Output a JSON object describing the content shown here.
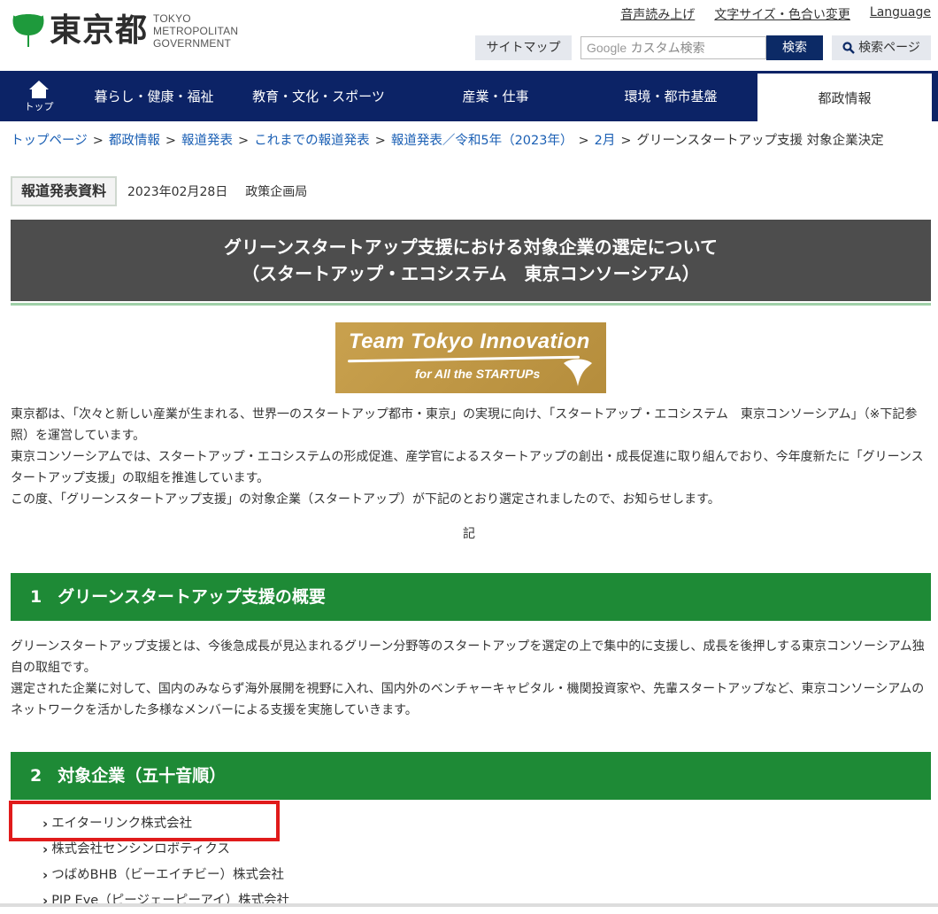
{
  "header": {
    "logo_kanji": "東京都",
    "logo_en_line1": "TOKYO METROPOLITAN",
    "logo_en_line2": "GOVERNMENT",
    "util_links": [
      "音声読み上げ",
      "文字サイズ・色合い変更",
      "Language"
    ],
    "sitemap_label": "サイトマップ",
    "search_google": "Google",
    "search_placeholder": "カスタム検索",
    "search_button": "検索",
    "search_page_button": "検索ページ"
  },
  "nav": {
    "home_label": "トップ",
    "items": [
      "暮らし・健康・福祉",
      "教育・文化・スポーツ",
      "産業・仕事",
      "環境・都市基盤",
      "都政情報"
    ],
    "active_index": 4
  },
  "breadcrumb": {
    "links": [
      "トップページ",
      "都政情報",
      "報道発表",
      "これまでの報道発表",
      "報道発表／令和5年（2023年）",
      "2月"
    ],
    "current": "グリーンスタートアップ支援 対象企業決定"
  },
  "meta": {
    "badge": "報道発表資料",
    "date": "2023年02月28日",
    "department": "政策企画局"
  },
  "title": {
    "line1": "グリーンスタートアップ支援における対象企業の選定について",
    "line2": "（スタートアップ・エコシステム　東京コンソーシアム）"
  },
  "banner": {
    "title": "Team Tokyo Innovation",
    "subtitle": "for All the STARTUPs"
  },
  "intro": {
    "p1": "東京都は、「次々と新しい産業が生まれる、世界一のスタートアップ都市・東京」の実現に向け、「スタートアップ・エコシステム　東京コンソーシアム」（※下記参照）を運営しています。",
    "p2": "東京コンソーシアムでは、スタートアップ・エコシステムの形成促進、産学官によるスタートアップの創出・成長促進に取り組んでおり、今年度新たに「グリーンスタートアップ支援」の取組を推進しています。",
    "p3": "この度、「グリーンスタートアップ支援」の対象企業（スタートアップ）が下記のとおり選定されましたので、お知らせします。",
    "ki": "記"
  },
  "section1": {
    "num": "1",
    "title": "グリーンスタートアップ支援の概要",
    "p1": "グリーンスタートアップ支援とは、今後急成長が見込まれるグリーン分野等のスタートアップを選定の上で集中的に支援し、成長を後押しする東京コンソーシアム独自の取組です。",
    "p2": "選定された企業に対して、国内のみならず海外展開を視野に入れ、国内外のベンチャーキャピタル・機関投資家や、先輩スタートアップなど、東京コンソーシアムのネットワークを活かした多様なメンバーによる支援を実施していきます。"
  },
  "section2": {
    "num": "2",
    "title": "対象企業（五十音順）",
    "companies": [
      "エイターリンク株式会社",
      "株式会社センシンロボティクス",
      "つばめBHB（ビーエイチビー）株式会社",
      "PJP Eye（ピージェーピーアイ）株式会社"
    ]
  },
  "colors": {
    "nav_bg": "#0c2366",
    "section_green": "#1e8a36",
    "title_bg": "#4d4d4d",
    "logo_green": "#1e9a3c",
    "highlight_red": "#e01b1b"
  }
}
